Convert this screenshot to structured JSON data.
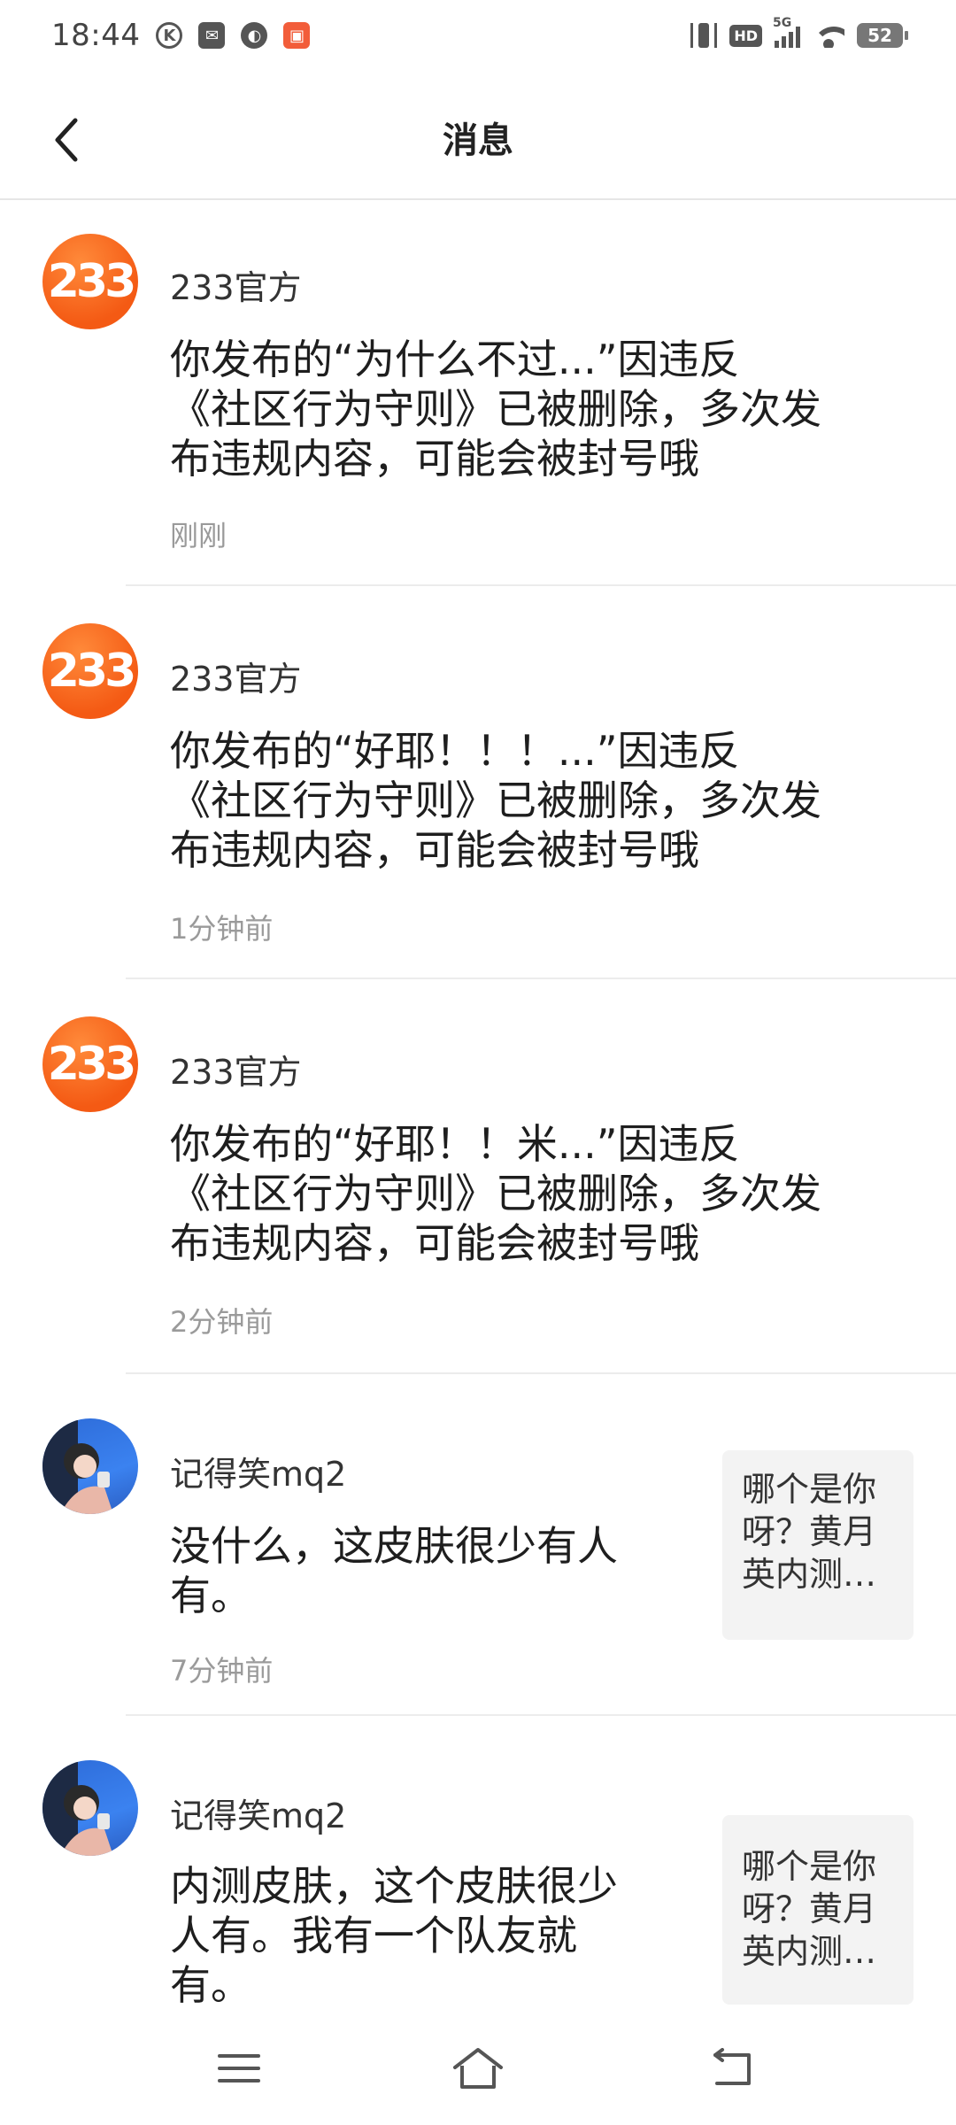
{
  "status_bar": {
    "time": "18:44",
    "battery": "52",
    "hd_label": "HD",
    "network_label": "5G"
  },
  "header": {
    "title": "消息"
  },
  "messages": [
    {
      "sender": "233官方",
      "avatar_text": "233",
      "content_lines": [
        "你发布的“为什么不过...”因违反",
        "《社区行为守则》已被删除，多次发",
        "布违规内容，可能会被封号哦"
      ],
      "time": "刚刚"
    },
    {
      "sender": "233官方",
      "avatar_text": "233",
      "content_lines": [
        "你发布的“好耶！！！...”因违反",
        "《社区行为守则》已被删除，多次发",
        "布违规内容，可能会被封号哦"
      ],
      "time": "1分钟前"
    },
    {
      "sender": "233官方",
      "avatar_text": "233",
      "content_lines": [
        "你发布的“好耶！！米...”因违反",
        "《社区行为守则》已被删除，多次发",
        "布违规内容，可能会被封号哦"
      ],
      "time": "2分钟前"
    },
    {
      "sender": "记得笑mq2",
      "content_lines": [
        "没什么，这皮肤很少有人",
        "有。"
      ],
      "time": "7分钟前",
      "quote_lines": [
        "哪个是你",
        "呀？黄月",
        "英内测…"
      ]
    },
    {
      "sender": "记得笑mq2",
      "content_lines": [
        "内测皮肤，这个皮肤很少",
        "人有。我有一个队友就",
        "有。"
      ],
      "quote_lines": [
        "哪个是你",
        "呀？黄月",
        "英内测…"
      ]
    }
  ],
  "colors": {
    "official_avatar": "#f45a14",
    "user_avatar": "#3b82f0",
    "divider": "#ececec",
    "time_text": "#9a9a9a"
  }
}
